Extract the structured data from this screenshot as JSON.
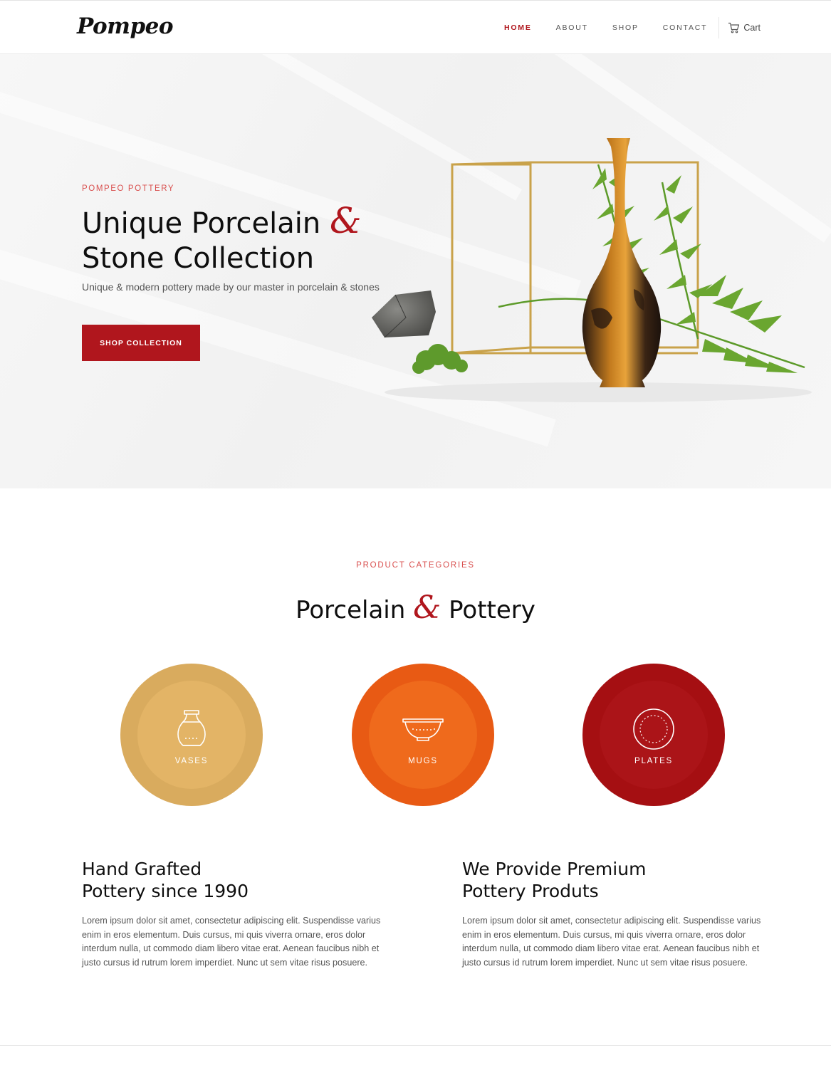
{
  "header": {
    "logo": "Pompeo",
    "nav": [
      "HOME",
      "ABOUT",
      "SHOP",
      "CONTACT"
    ],
    "active": "HOME",
    "cart_label": "Cart"
  },
  "hero": {
    "eyebrow": "POMPEO POTTERY",
    "title_line1": "Unique Porcelain",
    "amp": "&",
    "title_line2": "Stone Collection",
    "subtitle": "Unique & modern pottery made by our master in porcelain & stones",
    "button": "SHOP COLLECTION"
  },
  "categories": {
    "eyebrow": "PRODUCT CATEGORIES",
    "title_left": "Porcelain",
    "amp": "&",
    "title_right": "Pottery",
    "items": [
      {
        "label": "VASES",
        "icon": "vase-icon",
        "outer": "#d9ab5e",
        "inner": "#e3b466"
      },
      {
        "label": "MUGS",
        "icon": "bowl-icon",
        "outer": "#e85a14",
        "inner": "#ef6a1c"
      },
      {
        "label": "PLATES",
        "icon": "plate-icon",
        "outer": "#a50f12",
        "inner": "#ab1418"
      }
    ]
  },
  "blocks": [
    {
      "title_line1": "Hand Grafted",
      "title_line2": "Pottery since 1990",
      "body": "Lorem ipsum dolor sit amet, consectetur adipiscing elit. Suspendisse varius enim in eros elementum. Duis cursus, mi quis viverra ornare, eros dolor interdum nulla, ut commodo diam libero vitae erat. Aenean faucibus nibh et justo cursus id rutrum lorem imperdiet. Nunc ut sem vitae risus posuere."
    },
    {
      "title_line1": "We Provide Premium",
      "title_line2": "Pottery Produts",
      "body": "Lorem ipsum dolor sit amet, consectetur adipiscing elit. Suspendisse varius enim in eros elementum. Duis cursus, mi quis viverra ornare, eros dolor interdum nulla, ut commodo diam libero vitae erat. Aenean faucibus nibh et justo cursus id rutrum lorem imperdiet. Nunc ut sem vitae risus posuere."
    }
  ],
  "colors": {
    "accent": "#b0161d",
    "eyebrow": "#d9504f"
  }
}
